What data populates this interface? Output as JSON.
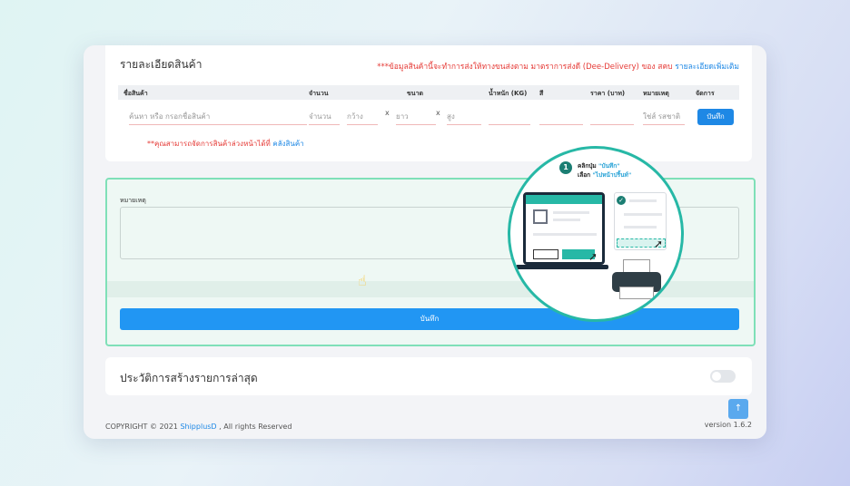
{
  "product_card": {
    "title": "รายละเอียดสินค้า",
    "notice": "***ข้อมูลสินค้านี้จะทำการส่งให้ทางขนส่งตาม มาตราการส่งดี (Dee-Delivery) ของ สคบ",
    "notice_link": "รายละเอียดเพิ่มเติม",
    "columns": [
      "ชื่อสินค้า",
      "จำนวน",
      "ขนาด",
      "น้ำหนัก (KG)",
      "สี",
      "ราคา (บาท)",
      "หมายเหตุ",
      "จัดการ"
    ],
    "row": {
      "product_placeholder": "ค้นหา หรือ กรอกชื่อสินค้า",
      "quantity_placeholder": "จำนวน",
      "width_placeholder": "กว้าง",
      "length_placeholder": "ยาว",
      "height_placeholder": "สูง",
      "times": "x",
      "note_placeholder": "ใช่ส์ รสชาติ",
      "save_label": "บันทึก"
    },
    "hint": "**คุณสามารถจัดการสินค้าล่วงหน้าได้ที่",
    "hint_link": "คลังสินค้า"
  },
  "note_card": {
    "label": "หมายเหตุ",
    "save_label": "บันทึก"
  },
  "history": {
    "title": "ประวัติการสร้างรายการล่าสุด",
    "toggle_on": false
  },
  "footer": {
    "copyright": "COPYRIGHT © 2021",
    "brand": "ShipplusD",
    "rights": ", All rights Reserved",
    "version": "version 1.6.2"
  },
  "callout": {
    "step": "1",
    "line1_prefix": "คลิกปุ่ม ",
    "line1_highlight": "\"บันทึก\"",
    "line2_prefix": "เลือก ",
    "line2_highlight": "\"ไปหน้าปริ้นท์\""
  },
  "colors": {
    "accent": "#2196f3",
    "teal": "#27b8a6",
    "warning": "#e53935",
    "green_border": "#7fe0b8"
  }
}
